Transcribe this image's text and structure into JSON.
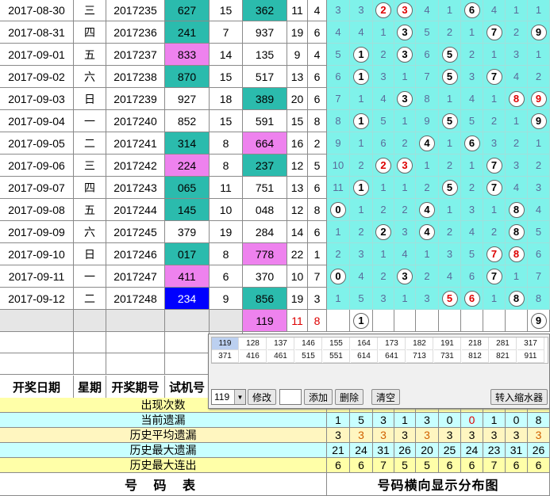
{
  "rows": [
    {
      "date": "2017-08-30",
      "weekday": "三",
      "issue": "2017235",
      "trial": "627",
      "span": "15",
      "draw": "362",
      "sum": "11",
      "n": "4",
      "trial_color": "teal",
      "draw_color": "teal",
      "dist": [
        {
          "v": "3"
        },
        {
          "v": "3"
        },
        {
          "v": "2",
          "b": "red"
        },
        {
          "v": "3",
          "b": "red"
        },
        {
          "v": "4"
        },
        {
          "v": "1"
        },
        {
          "v": "6",
          "b": "black"
        },
        {
          "v": "4"
        },
        {
          "v": "1"
        },
        {
          "v": "1"
        }
      ]
    },
    {
      "date": "2017-08-31",
      "weekday": "四",
      "issue": "2017236",
      "trial": "241",
      "span": "7",
      "draw": "937",
      "sum": "19",
      "n": "6",
      "trial_color": "teal",
      "draw_color": "none",
      "dist": [
        {
          "v": "4"
        },
        {
          "v": "4"
        },
        {
          "v": "1"
        },
        {
          "v": "3",
          "b": "black"
        },
        {
          "v": "5"
        },
        {
          "v": "2"
        },
        {
          "v": "1"
        },
        {
          "v": "7",
          "b": "black"
        },
        {
          "v": "2"
        },
        {
          "v": "9",
          "b": "black"
        }
      ]
    },
    {
      "date": "2017-09-01",
      "weekday": "五",
      "issue": "2017237",
      "trial": "833",
      "span": "14",
      "draw": "135",
      "sum": "9",
      "n": "4",
      "trial_color": "pink",
      "draw_color": "none",
      "dist": [
        {
          "v": "5"
        },
        {
          "v": "1",
          "b": "black"
        },
        {
          "v": "2"
        },
        {
          "v": "3",
          "b": "black"
        },
        {
          "v": "6"
        },
        {
          "v": "5",
          "b": "black"
        },
        {
          "v": "2"
        },
        {
          "v": "1"
        },
        {
          "v": "3"
        },
        {
          "v": "1"
        }
      ]
    },
    {
      "date": "2017-09-02",
      "weekday": "六",
      "issue": "2017238",
      "trial": "870",
      "span": "15",
      "draw": "517",
      "sum": "13",
      "n": "6",
      "trial_color": "teal",
      "draw_color": "none",
      "dist": [
        {
          "v": "6"
        },
        {
          "v": "1",
          "b": "black"
        },
        {
          "v": "3"
        },
        {
          "v": "1"
        },
        {
          "v": "7"
        },
        {
          "v": "5",
          "b": "black"
        },
        {
          "v": "3"
        },
        {
          "v": "7",
          "b": "black"
        },
        {
          "v": "4"
        },
        {
          "v": "2"
        }
      ]
    },
    {
      "date": "2017-09-03",
      "weekday": "日",
      "issue": "2017239",
      "trial": "927",
      "span": "18",
      "draw": "389",
      "sum": "20",
      "n": "6",
      "trial_color": "none",
      "draw_color": "teal",
      "dist": [
        {
          "v": "7"
        },
        {
          "v": "1"
        },
        {
          "v": "4"
        },
        {
          "v": "3",
          "b": "black"
        },
        {
          "v": "8"
        },
        {
          "v": "1"
        },
        {
          "v": "4"
        },
        {
          "v": "1"
        },
        {
          "v": "8",
          "b": "red"
        },
        {
          "v": "9",
          "b": "red"
        }
      ]
    },
    {
      "date": "2017-09-04",
      "weekday": "一",
      "issue": "2017240",
      "trial": "852",
      "span": "15",
      "draw": "591",
      "sum": "15",
      "n": "8",
      "trial_color": "none",
      "draw_color": "none",
      "dist": [
        {
          "v": "8"
        },
        {
          "v": "1",
          "b": "black"
        },
        {
          "v": "5"
        },
        {
          "v": "1"
        },
        {
          "v": "9"
        },
        {
          "v": "5",
          "b": "black"
        },
        {
          "v": "5"
        },
        {
          "v": "2"
        },
        {
          "v": "1"
        },
        {
          "v": "9",
          "b": "black"
        }
      ]
    },
    {
      "date": "2017-09-05",
      "weekday": "二",
      "issue": "2017241",
      "trial": "314",
      "span": "8",
      "draw": "664",
      "sum": "16",
      "n": "2",
      "trial_color": "teal",
      "draw_color": "pink",
      "dist": [
        {
          "v": "9"
        },
        {
          "v": "1"
        },
        {
          "v": "6"
        },
        {
          "v": "2"
        },
        {
          "v": "4",
          "b": "black"
        },
        {
          "v": "1"
        },
        {
          "v": "6",
          "b": "black"
        },
        {
          "v": "3"
        },
        {
          "v": "2"
        },
        {
          "v": "1"
        }
      ]
    },
    {
      "date": "2017-09-06",
      "weekday": "三",
      "issue": "2017242",
      "trial": "224",
      "span": "8",
      "draw": "237",
      "sum": "12",
      "n": "5",
      "trial_color": "pink",
      "draw_color": "teal",
      "dist": [
        {
          "v": "10"
        },
        {
          "v": "2"
        },
        {
          "v": "2",
          "b": "red"
        },
        {
          "v": "3",
          "b": "red"
        },
        {
          "v": "1"
        },
        {
          "v": "2"
        },
        {
          "v": "1"
        },
        {
          "v": "7",
          "b": "black"
        },
        {
          "v": "3"
        },
        {
          "v": "2"
        }
      ]
    },
    {
      "date": "2017-09-07",
      "weekday": "四",
      "issue": "2017243",
      "trial": "065",
      "span": "11",
      "draw": "751",
      "sum": "13",
      "n": "6",
      "trial_color": "teal",
      "draw_color": "none",
      "dist": [
        {
          "v": "11"
        },
        {
          "v": "1",
          "b": "black"
        },
        {
          "v": "1"
        },
        {
          "v": "1"
        },
        {
          "v": "2"
        },
        {
          "v": "5",
          "b": "black"
        },
        {
          "v": "2"
        },
        {
          "v": "7",
          "b": "black"
        },
        {
          "v": "4"
        },
        {
          "v": "3"
        }
      ]
    },
    {
      "date": "2017-09-08",
      "weekday": "五",
      "issue": "2017244",
      "trial": "145",
      "span": "10",
      "draw": "048",
      "sum": "12",
      "n": "8",
      "trial_color": "teal",
      "draw_color": "none",
      "dist": [
        {
          "v": "0",
          "b": "black"
        },
        {
          "v": "1"
        },
        {
          "v": "2"
        },
        {
          "v": "2"
        },
        {
          "v": "4",
          "b": "black"
        },
        {
          "v": "1"
        },
        {
          "v": "3"
        },
        {
          "v": "1"
        },
        {
          "v": "8",
          "b": "black"
        },
        {
          "v": "4"
        }
      ]
    },
    {
      "date": "2017-09-09",
      "weekday": "六",
      "issue": "2017245",
      "trial": "379",
      "span": "19",
      "draw": "284",
      "sum": "14",
      "n": "6",
      "trial_color": "none",
      "draw_color": "none",
      "dist": [
        {
          "v": "1"
        },
        {
          "v": "2"
        },
        {
          "v": "2",
          "b": "black"
        },
        {
          "v": "3"
        },
        {
          "v": "4",
          "b": "black"
        },
        {
          "v": "2"
        },
        {
          "v": "4"
        },
        {
          "v": "2"
        },
        {
          "v": "8",
          "b": "black"
        },
        {
          "v": "5"
        }
      ]
    },
    {
      "date": "2017-09-10",
      "weekday": "日",
      "issue": "2017246",
      "trial": "017",
      "span": "8",
      "draw": "778",
      "sum": "22",
      "n": "1",
      "trial_color": "teal",
      "draw_color": "pink",
      "dist": [
        {
          "v": "2"
        },
        {
          "v": "3"
        },
        {
          "v": "1"
        },
        {
          "v": "4"
        },
        {
          "v": "1"
        },
        {
          "v": "3"
        },
        {
          "v": "5"
        },
        {
          "v": "7",
          "b": "red"
        },
        {
          "v": "8",
          "b": "red"
        },
        {
          "v": "6"
        }
      ]
    },
    {
      "date": "2017-09-11",
      "weekday": "一",
      "issue": "2017247",
      "trial": "411",
      "span": "6",
      "draw": "370",
      "sum": "10",
      "n": "7",
      "trial_color": "pink",
      "draw_color": "none",
      "dist": [
        {
          "v": "0",
          "b": "black"
        },
        {
          "v": "4"
        },
        {
          "v": "2"
        },
        {
          "v": "3",
          "b": "black"
        },
        {
          "v": "2"
        },
        {
          "v": "4"
        },
        {
          "v": "6"
        },
        {
          "v": "7",
          "b": "black"
        },
        {
          "v": "1"
        },
        {
          "v": "7"
        }
      ]
    },
    {
      "date": "2017-09-12",
      "weekday": "二",
      "issue": "2017248",
      "trial": "234",
      "span": "9",
      "draw": "856",
      "sum": "19",
      "n": "3",
      "trial_color": "blue",
      "draw_color": "teal",
      "dist": [
        {
          "v": "1"
        },
        {
          "v": "5"
        },
        {
          "v": "3"
        },
        {
          "v": "1"
        },
        {
          "v": "3"
        },
        {
          "v": "5",
          "b": "red"
        },
        {
          "v": "6",
          "b": "red"
        },
        {
          "v": "1"
        },
        {
          "v": "8",
          "b": "black"
        },
        {
          "v": "8"
        }
      ]
    }
  ],
  "predict_row": {
    "draw": "119",
    "sum": "11",
    "n": "8",
    "balls": [
      {
        "col": 1,
        "v": "1"
      },
      {
        "col": 9,
        "v": "9"
      }
    ]
  },
  "header": {
    "date": "开奖日期",
    "weekday": "星期",
    "issue": "开奖期号",
    "trial": "试机号"
  },
  "stats": [
    {
      "label": "出现次数",
      "values": [
        "",
        "",
        "",
        "",
        "",
        "",
        "",
        "",
        "",
        ""
      ],
      "style": "y"
    },
    {
      "label": "当前遗漏",
      "values": [
        "1",
        "5",
        "3",
        "1",
        "3",
        "0",
        "0",
        "1",
        "0",
        "8"
      ],
      "style": "c"
    },
    {
      "label": "历史平均遗漏",
      "values": [
        "3",
        "3",
        "3",
        "3",
        "3",
        "3",
        "3",
        "3",
        "3",
        "3"
      ],
      "style": "y2"
    },
    {
      "label": "历史最大遗漏",
      "values": [
        "21",
        "24",
        "31",
        "26",
        "20",
        "25",
        "24",
        "23",
        "31",
        "26"
      ],
      "style": "c"
    },
    {
      "label": "历史最大连出",
      "values": [
        "6",
        "6",
        "7",
        "5",
        "5",
        "6",
        "6",
        "7",
        "6",
        "6"
      ],
      "style": "y"
    }
  ],
  "footer": {
    "left": "号 码 表",
    "right": "号码横向显示分布图"
  },
  "panel": {
    "grid_row1": [
      "119",
      "128",
      "137",
      "146",
      "155",
      "164",
      "173",
      "182",
      "191",
      "218",
      "281",
      "317"
    ],
    "grid_row2": [
      "371",
      "416",
      "461",
      "515",
      "551",
      "614",
      "641",
      "713",
      "731",
      "812",
      "821",
      "911"
    ],
    "select_value": "119",
    "btn_modify": "修改",
    "btn_add": "添加",
    "btn_delete": "删除",
    "btn_clear": "清空",
    "btn_shrink": "转入缩水器"
  }
}
